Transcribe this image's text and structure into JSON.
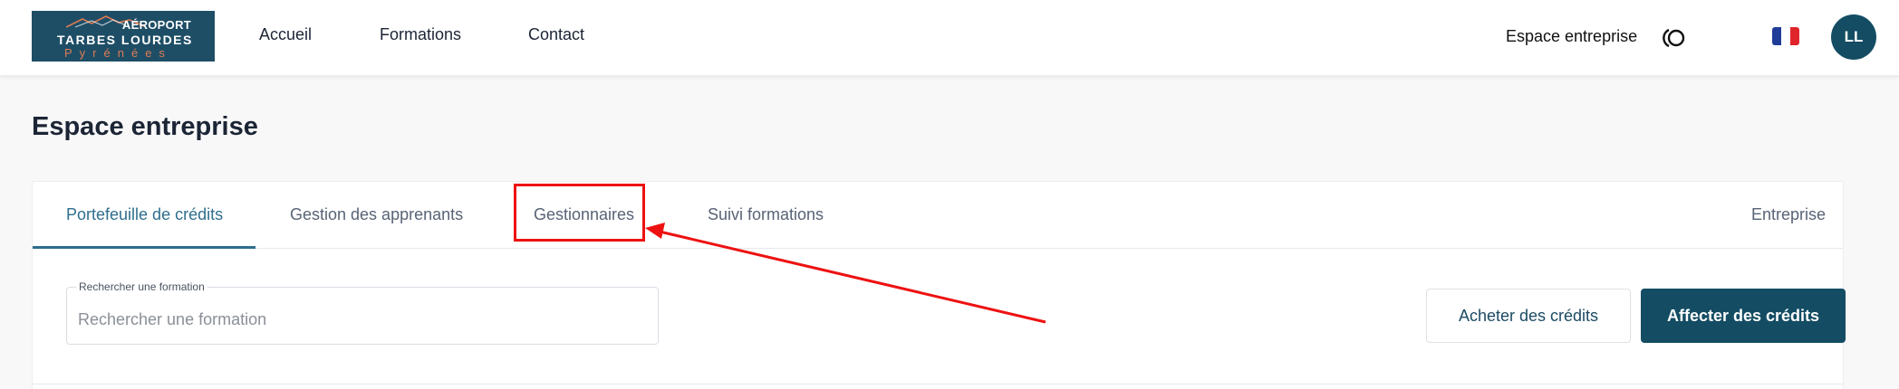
{
  "header": {
    "logo": {
      "line1": "AÉROPORT",
      "line2": "TARBES LOURDES",
      "line3": "Pyrénées"
    },
    "nav": [
      {
        "label": "Accueil"
      },
      {
        "label": "Formations"
      },
      {
        "label": "Contact"
      }
    ],
    "espace_link": "Espace entreprise",
    "theme_icon": "contrast-icon",
    "language_icon": "french-flag-icon",
    "avatar_initials": "LL"
  },
  "page": {
    "title": "Espace entreprise",
    "tabs": [
      {
        "label": "Portefeuille de crédits",
        "active": true
      },
      {
        "label": "Gestion des apprenants",
        "active": false
      },
      {
        "label": "Gestionnaires",
        "active": false
      },
      {
        "label": "Suivi formations",
        "active": false
      },
      {
        "label": "Entreprise",
        "active": false
      }
    ],
    "search": {
      "label": "Rechercher une formation",
      "placeholder": "Rechercher une formation",
      "value": ""
    },
    "buttons": {
      "buy_credits": "Acheter des crédits",
      "assign_credits": "Affecter des crédits"
    }
  },
  "colors": {
    "brand": "#134c63",
    "accent": "#2e6e8e",
    "annotation": "#ee1111"
  }
}
